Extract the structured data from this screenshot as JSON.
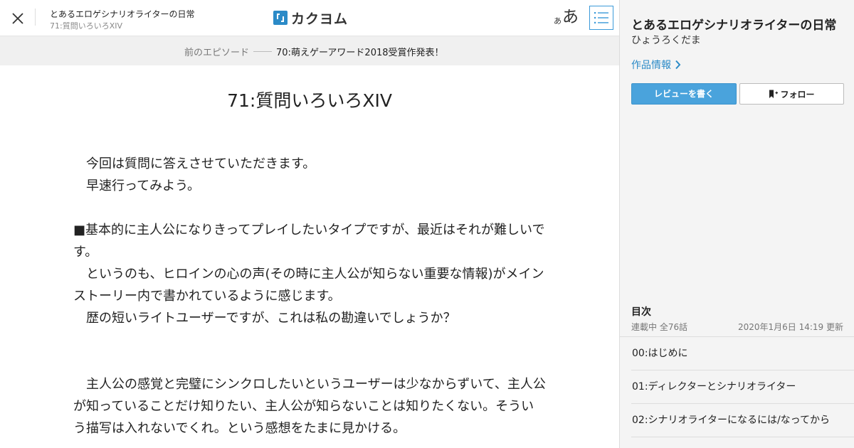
{
  "header": {
    "work_title": "とあるエロゲシナリオライターの日常",
    "episode_subtitle": "71:質問いろいろXIV",
    "logo_text": "カクヨム",
    "font_toggle_small": "あ",
    "font_toggle_large": "あ",
    "close_icon": "close-icon",
    "toc_icon": "list-icon"
  },
  "episode_nav": {
    "prev_label": "前のエピソード",
    "prev_title": "70:萌えゲーアワード2018受賞作発表！"
  },
  "main": {
    "episode_title": "71:質問いろいろXIV",
    "paragraphs": [
      "　今回は質問に答えさせていただきます。",
      "　早速行ってみよう。",
      "",
      "■基本的に主人公になりきってプレイしたいタイプですが、最近はそれが難しいです。",
      "　というのも、ヒロインの心の声(その時に主人公が知らない重要な情報)がメインストーリー内で書かれているように感じます。",
      "　歴の短いライトユーザーですが、これは私の勘違いでしょうか？",
      "",
      "",
      "　主人公の感覚と完璧にシンクロしたいというユーザーは少なからずいて、主人公が知っていることだけ知りたい、主人公が知らないことは知りたくない。そういう描写は入れないでくれ。という感想をたまに見かける。"
    ]
  },
  "sidebar": {
    "title": "とあるエロゲシナリオライターの日常",
    "author": "ひょうろくだま",
    "info_link": "作品情報",
    "review_button": "レビューを書く",
    "follow_button": "フォロー",
    "toc_heading": "目次",
    "toc_status": "連載中 全76話",
    "toc_updated": "2020年1月6日 14:19 更新",
    "toc_items": [
      "00:はじめに",
      "01:ディレクターとシナリオライター",
      "02:シナリオライターになるには/なってから"
    ],
    "accent_color": "#2b8ac7"
  }
}
